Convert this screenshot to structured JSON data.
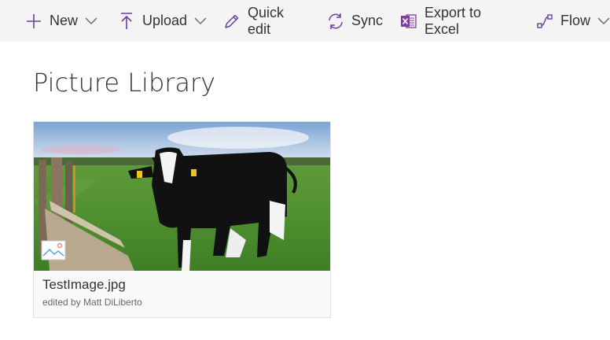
{
  "command_bar": {
    "items": [
      {
        "label": "New",
        "icon": "plus-icon",
        "has_dropdown": true
      },
      {
        "label": "Upload",
        "icon": "upload-icon",
        "has_dropdown": true
      },
      {
        "label": "Quick edit",
        "icon": "pencil-icon",
        "has_dropdown": false
      },
      {
        "label": "Sync",
        "icon": "sync-icon",
        "has_dropdown": false
      },
      {
        "label": "Export to Excel",
        "icon": "excel-icon",
        "has_dropdown": false
      },
      {
        "label": "Flow",
        "icon": "flow-icon",
        "has_dropdown": true
      }
    ]
  },
  "page": {
    "title": "Picture Library"
  },
  "library": {
    "items": [
      {
        "name": "TestImage.jpg",
        "meta": "edited by Matt DiLiberto",
        "type_icon": "image-file-icon",
        "thumbnail": "cow-in-pasture-photo"
      }
    ]
  },
  "colors": {
    "accent_purple": "#6b3fa0",
    "excel_purple": "#7f3e9b",
    "commandbar_bg": "#f4f4f4"
  }
}
